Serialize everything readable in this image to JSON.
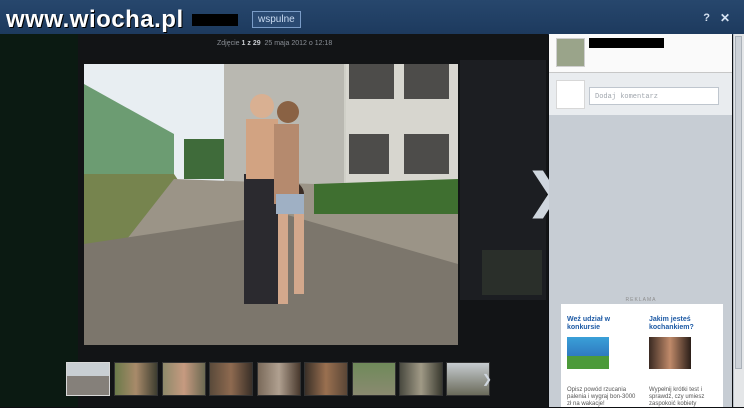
{
  "topbar": {
    "watermark": "www.wiocha.pl",
    "tag": "wspulne",
    "help_icon": "?",
    "close_icon": "✕"
  },
  "viewer": {
    "photo_label": "Zdjęcie",
    "photo_index": "1 z 29",
    "date": "25 maja 2012 o 12:18",
    "next_arrow": "❯",
    "thumb_next": "❯"
  },
  "panel": {
    "comment_placeholder": "Dodaj komentarz",
    "ads_label": "REKLAMA",
    "ad1_title": "Weź udział w konkursie",
    "ad1_text": "Opisz powód rzucania palenia i wygraj bon-3000 zł na wakacje!",
    "ad2_title": "Jakim jesteś kochankiem?",
    "ad2_text": "Wypełnij krótki test i sprawdź, czy umiesz zaspokoić kobiety"
  }
}
